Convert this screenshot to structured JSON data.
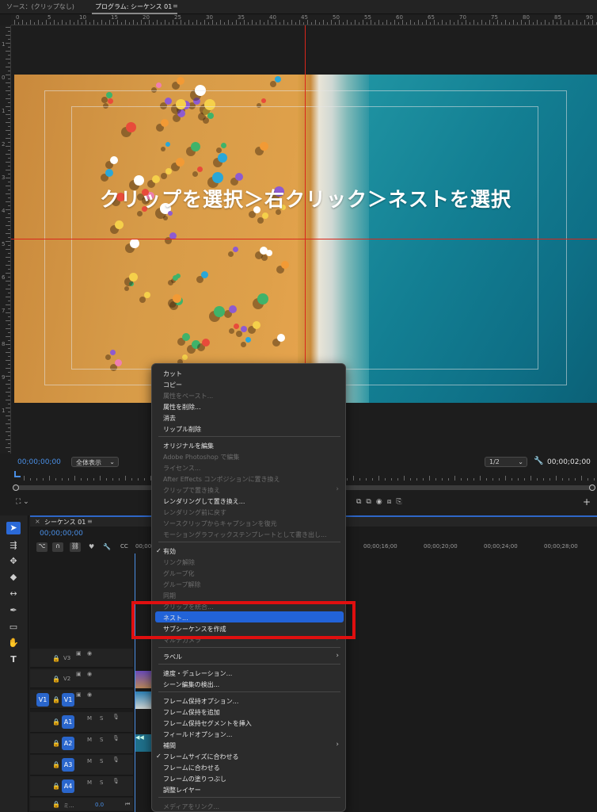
{
  "tabs": {
    "source": "ソース：(クリップなし)",
    "program": "プログラム: シーケンス 01",
    "program_menu": "≡"
  },
  "ruler_top_labels": [
    "0",
    "5",
    "10",
    "15",
    "20",
    "25",
    "30",
    "35",
    "40",
    "45",
    "50",
    "55",
    "60",
    "65",
    "70",
    "75",
    "80",
    "85",
    "90"
  ],
  "ruler_left_labels": [
    "1",
    "0",
    "1",
    "2",
    "3",
    "4",
    "5",
    "6",
    "7",
    "8",
    "9",
    "1"
  ],
  "overlay_text": "クリップを選択＞右クリック＞ネストを選択",
  "monitor": {
    "timecode_left": "00;00;00;00",
    "fit": "全体表示",
    "resolution": "1/2",
    "timecode_right": "00;00;02;00"
  },
  "timeline": {
    "tab": "シーケンス 01",
    "menu": "≡",
    "timecode": "00;00;00;00",
    "ruler": [
      "00;00",
      "00;00;16;00",
      "00;00;20;00",
      "00;00;24;00",
      "00;00;28;00"
    ],
    "video_tracks": [
      {
        "label": "V3"
      },
      {
        "label": "V2"
      },
      {
        "label": "V1",
        "target": "V1"
      }
    ],
    "audio_tracks": [
      {
        "label": "A1"
      },
      {
        "label": "A2"
      },
      {
        "label": "A3"
      },
      {
        "label": "A4"
      }
    ],
    "mix_label": "ミ...",
    "mix_value": "0.0"
  },
  "context_menu": {
    "items": [
      {
        "label": "カット",
        "enabled": true
      },
      {
        "label": "コピー",
        "enabled": true
      },
      {
        "label": "属性をペースト...",
        "enabled": false
      },
      {
        "label": "属性を削除...",
        "enabled": true
      },
      {
        "label": "消去",
        "enabled": true
      },
      {
        "label": "リップル削除",
        "enabled": true
      },
      {
        "label": "オリジナルを編集",
        "enabled": true
      },
      {
        "label": "Adobe Photoshop で編集",
        "enabled": false
      },
      {
        "label": "ライセンス...",
        "enabled": false
      },
      {
        "label": "After Effects コンポジションに置き換え",
        "enabled": false
      },
      {
        "label": "クリップで置き換え",
        "enabled": false
      },
      {
        "label": "レンダリングして置き換え...",
        "enabled": true
      },
      {
        "label": "レンダリング前に戻す",
        "enabled": false
      },
      {
        "label": "ソースクリップからキャプションを復元",
        "enabled": false
      },
      {
        "label": "モーショングラフィックステンプレートとして書き出し...",
        "enabled": false
      },
      {
        "label": "有効",
        "enabled": true,
        "checked": true
      },
      {
        "label": "リンク解除",
        "enabled": false
      },
      {
        "label": "グループ化",
        "enabled": false
      },
      {
        "label": "グループ解除",
        "enabled": false
      },
      {
        "label": "同期",
        "enabled": false
      },
      {
        "label": "クリップを統合...",
        "enabled": false
      },
      {
        "label": "ネスト...",
        "enabled": true,
        "highlighted": true
      },
      {
        "label": "サブシーケンスを作成",
        "enabled": true
      },
      {
        "label": "マルチカメラ",
        "enabled": false
      },
      {
        "label": "ラベル",
        "enabled": true
      },
      {
        "label": "速度・デュレーション...",
        "enabled": true
      },
      {
        "label": "シーン編集の検出...",
        "enabled": true
      },
      {
        "label": "フレーム保持オプション...",
        "enabled": true
      },
      {
        "label": "フレーム保持を追加",
        "enabled": true
      },
      {
        "label": "フレーム保持セグメントを挿入",
        "enabled": true
      },
      {
        "label": "フィールドオプション...",
        "enabled": true
      },
      {
        "label": "補間",
        "enabled": true
      },
      {
        "label": "フレームサイズに合わせる",
        "enabled": true,
        "checked": true
      },
      {
        "label": "フレームに合わせる",
        "enabled": true
      },
      {
        "label": "フレームの塗りつぶし",
        "enabled": true
      },
      {
        "label": "調整レイヤー",
        "enabled": true
      },
      {
        "label": "メディアをリンク...",
        "enabled": false
      }
    ],
    "submenu_arrow": "›"
  },
  "colors": {
    "accent": "#2263d8",
    "highlight_box": "#e00f0f",
    "timecode": "#4a8fe6",
    "guide": "#d9261c"
  }
}
